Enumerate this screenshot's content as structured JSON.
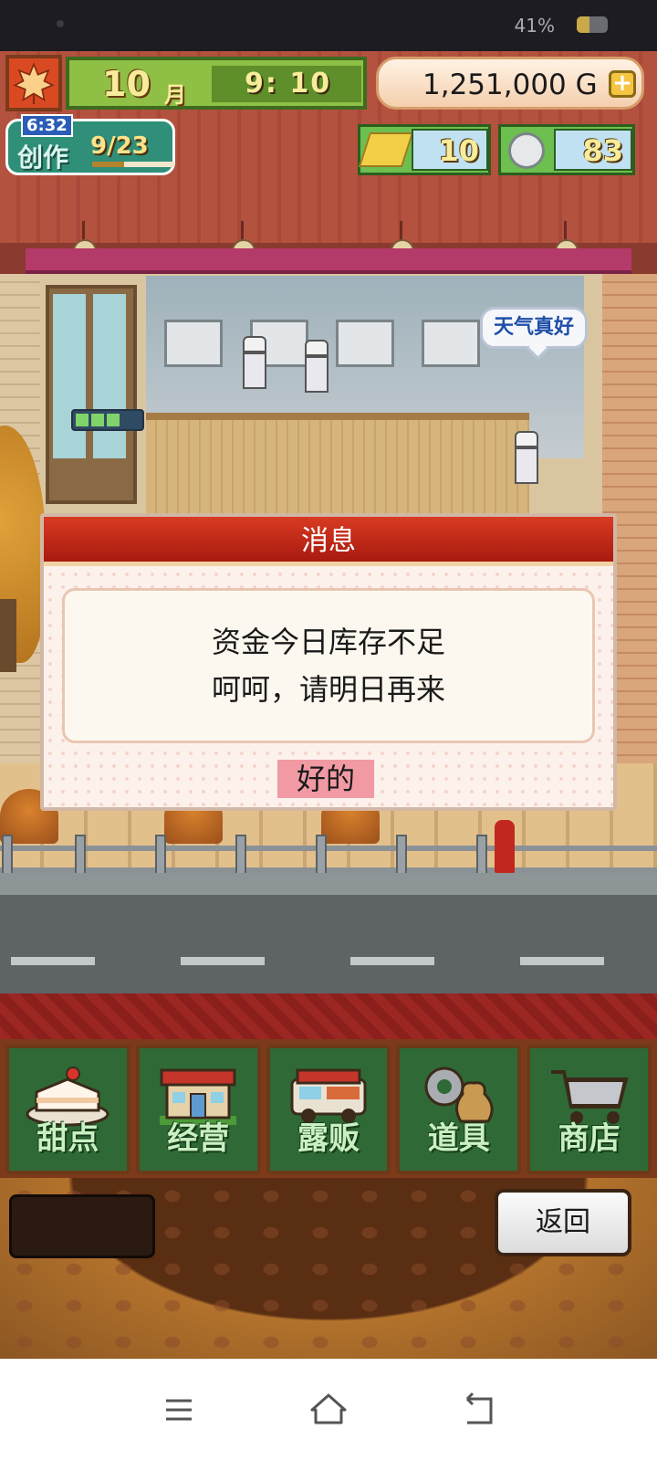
{
  "status_bar": {
    "battery_text": "41%",
    "battery_level": 0.41
  },
  "hud": {
    "month_num": "10",
    "month_label": "月",
    "time": "9: 10",
    "money": "1,251,000",
    "money_unit": "G",
    "money_plus": "+",
    "create": {
      "timer": "6:32",
      "label": "创作",
      "count": "9/23",
      "progress": 0.39
    },
    "gold_bars": "10",
    "coins": "83"
  },
  "scene": {
    "speech_bubble": "天气真好"
  },
  "dialog": {
    "title": "消息",
    "line1": "资金今日库存不足",
    "line2": "呵呵，请明日再来",
    "ok_label": "好的"
  },
  "menu": {
    "items": [
      {
        "label": "甜点",
        "icon": "cake-icon"
      },
      {
        "label": "经营",
        "icon": "shop-icon"
      },
      {
        "label": "露贩",
        "icon": "food-truck-icon"
      },
      {
        "label": "道具",
        "icon": "gear-bag-icon"
      },
      {
        "label": "商店",
        "icon": "cart-icon"
      }
    ]
  },
  "bottom": {
    "back_label": "返回"
  },
  "nav": {
    "icons": [
      "menu-icon",
      "home-icon",
      "back-icon"
    ]
  },
  "colors": {
    "dialog_header": "#c3271a",
    "ok_button": "#f19aa3",
    "menu_green": "#2f6a36"
  }
}
